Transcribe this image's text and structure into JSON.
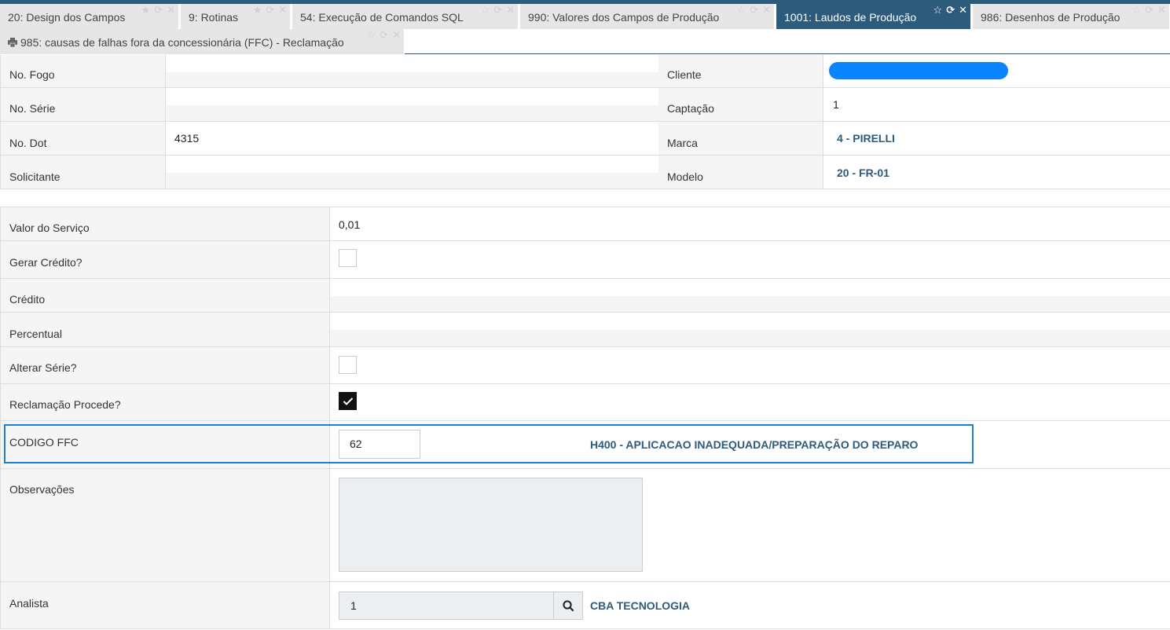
{
  "tabs": [
    {
      "label": "20: Design dos Campos",
      "active": false
    },
    {
      "label": "9: Rotinas",
      "active": false
    },
    {
      "label": "54: Execução de Comandos SQL",
      "active": false
    },
    {
      "label": "990: Valores dos Campos de Produção",
      "active": false
    },
    {
      "label": "1001: Laudos de Produção",
      "active": true
    },
    {
      "label": "986: Desenhos de Produção",
      "active": false
    },
    {
      "label": "985: causas de falhas fora da concessionária (FFC) - Reclamação",
      "active": false
    }
  ],
  "tab_icons": {
    "star": "☆",
    "star_filled": "★",
    "refresh": "⟳",
    "close": "✕"
  },
  "header_fields": {
    "no_fogo": {
      "label": "No. Fogo",
      "value": ""
    },
    "no_serie": {
      "label": "No. Série",
      "value": ""
    },
    "no_dot": {
      "label": "No. Dot",
      "value": "4315"
    },
    "solicitante": {
      "label": "Solicitante",
      "value": ""
    },
    "cliente": {
      "label": "Cliente",
      "value": ""
    },
    "captacao": {
      "label": "Captação",
      "value": "1"
    },
    "marca": {
      "label": "Marca",
      "value": "4 - PIRELLI"
    },
    "modelo": {
      "label": "Modelo",
      "value": "20 - FR-01"
    }
  },
  "details": {
    "valor_servico": {
      "label": "Valor do Serviço",
      "value": "0,01"
    },
    "gerar_credito": {
      "label": "Gerar Crédito?",
      "checked": false
    },
    "credito": {
      "label": "Crédito",
      "value": ""
    },
    "percentual": {
      "label": "Percentual",
      "value": ""
    },
    "alterar_serie": {
      "label": "Alterar Série?",
      "checked": false
    },
    "reclamacao_procede": {
      "label": "Reclamação Procede?",
      "checked": true
    },
    "codigo_ffc": {
      "label": "CODIGO FFC",
      "value": "62",
      "description": "H400 - APLICACAO INADEQUADA/PREPARAÇÃO DO REPARO"
    },
    "observacoes": {
      "label": "Observações",
      "value": ""
    },
    "analista": {
      "label": "Analista",
      "value": "1",
      "name": "CBA TECNOLOGIA"
    }
  },
  "colors": {
    "primary": "#2c5b7c",
    "highlight": "#1a7fd6",
    "client_pill": "#0a84ff",
    "label_bg": "#f5f5f5"
  }
}
